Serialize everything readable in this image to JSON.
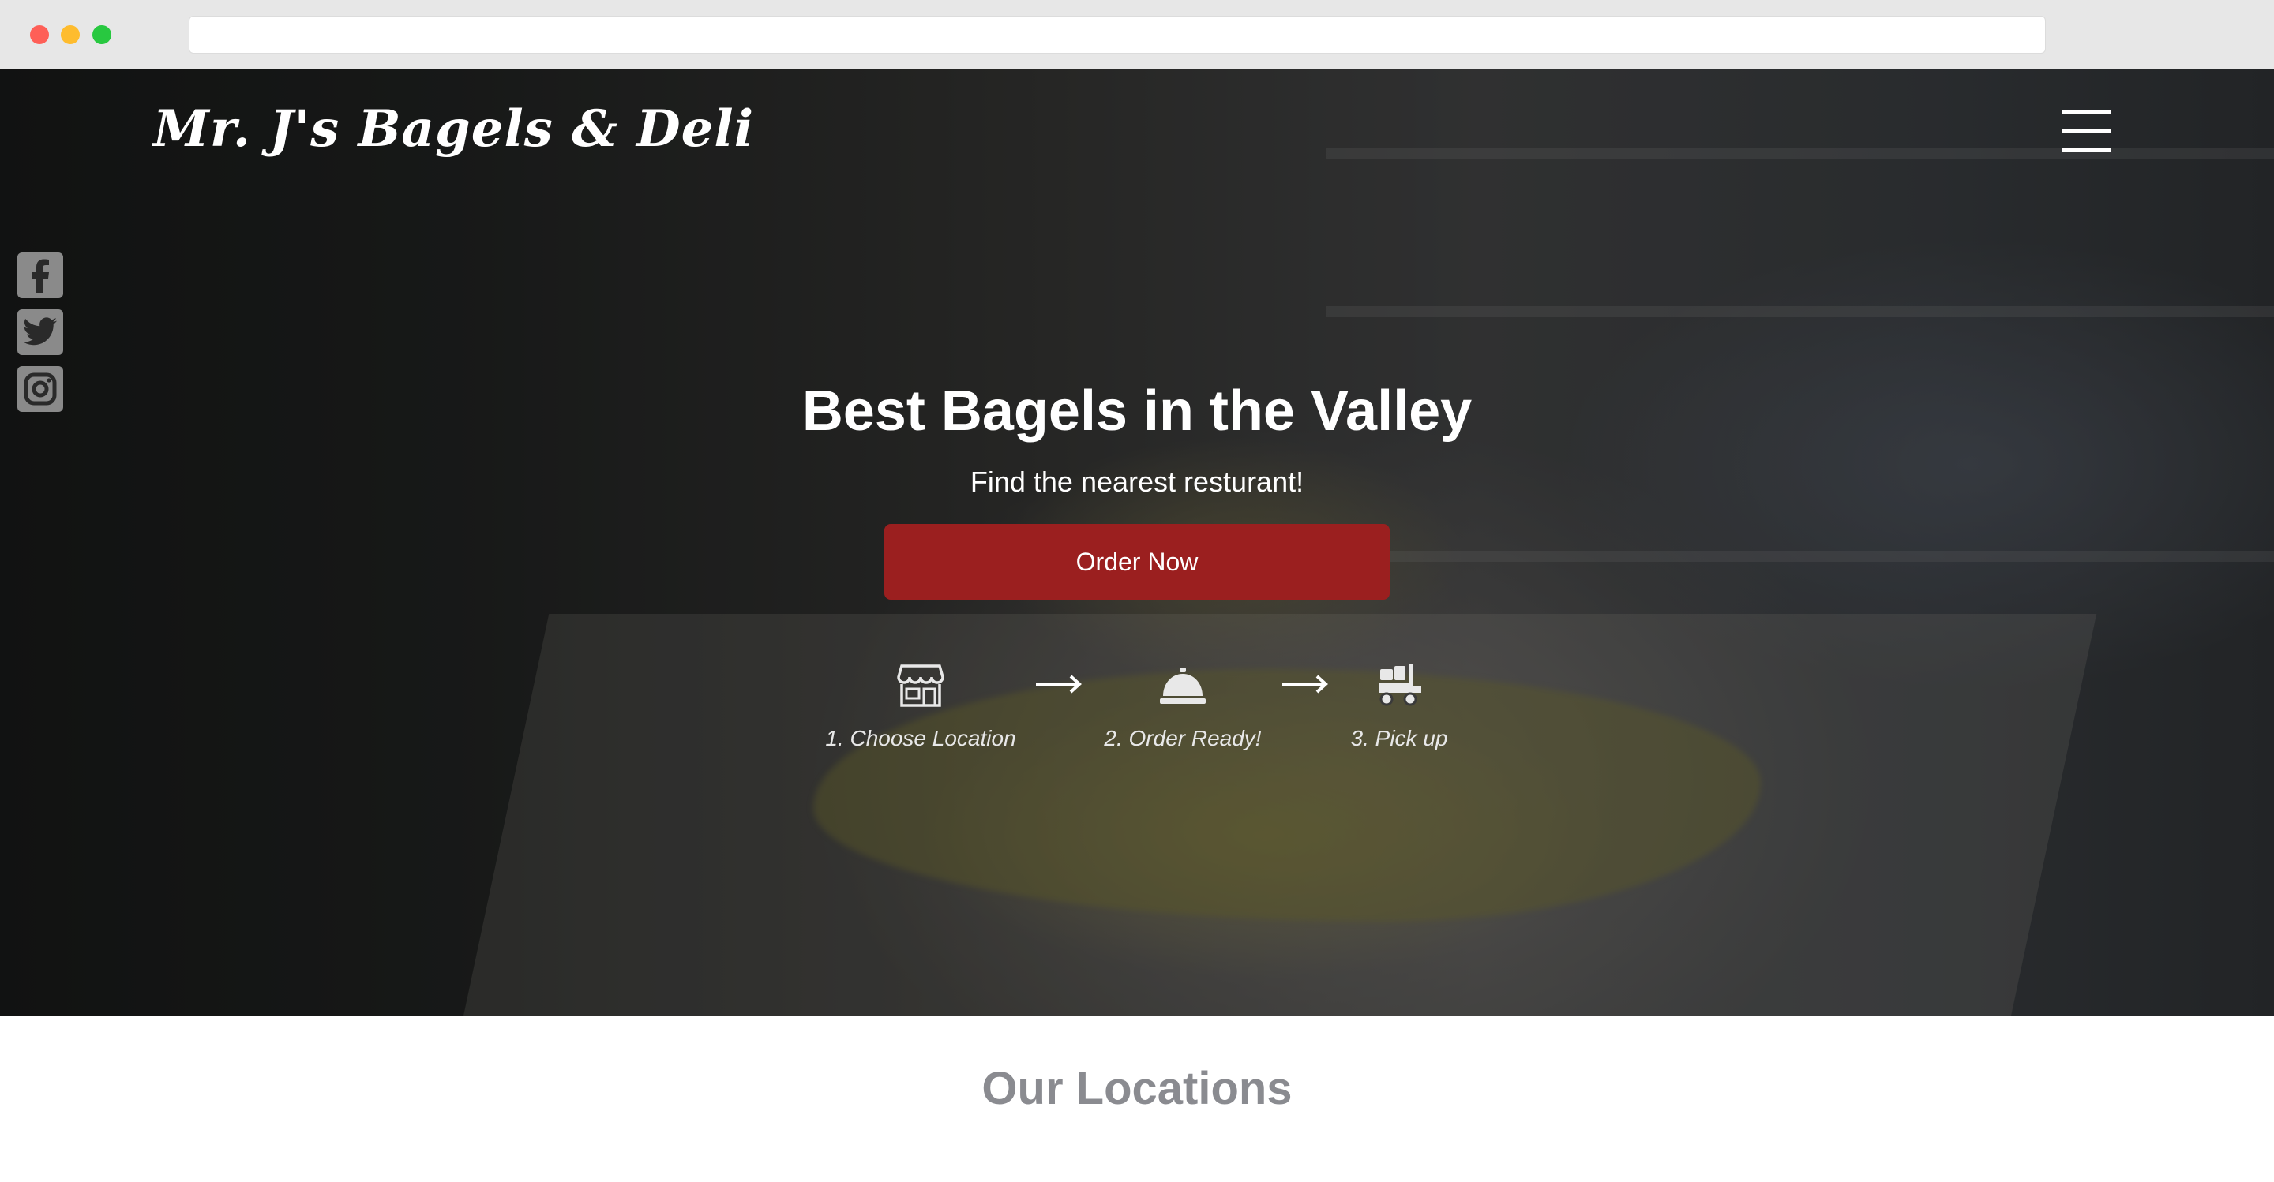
{
  "brand": {
    "name": "Mr. J's Bagels & Deli"
  },
  "nav": {
    "menu_icon": "hamburger-menu-icon"
  },
  "social": [
    {
      "icon": "facebook-icon"
    },
    {
      "icon": "twitter-icon"
    },
    {
      "icon": "instagram-icon"
    }
  ],
  "hero": {
    "title": "Best Bagels in the Valley",
    "subtitle": "Find the nearest resturant!",
    "cta_label": "Order Now",
    "steps": [
      {
        "icon": "storefront-icon",
        "label": "1. Choose Location"
      },
      {
        "icon": "service-bell-icon",
        "label": "2. Order Ready!"
      },
      {
        "icon": "truck-loading-icon",
        "label": "3. Pick up"
      }
    ]
  },
  "sections": {
    "locations_title": "Our Locations"
  },
  "colors": {
    "cta": "#9b1f1f",
    "section_title": "#8a8b90",
    "social_icon": "#8a8a8a"
  }
}
